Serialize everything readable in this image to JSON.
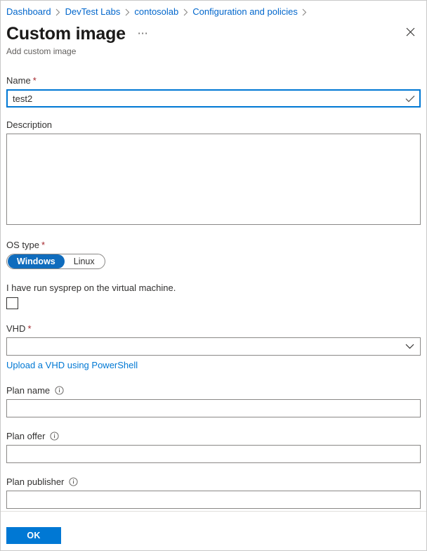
{
  "breadcrumb": {
    "items": [
      {
        "label": "Dashboard"
      },
      {
        "label": "DevTest Labs"
      },
      {
        "label": "contosolab"
      },
      {
        "label": "Configuration and policies"
      }
    ]
  },
  "header": {
    "title": "Custom image",
    "subtitle": "Add custom image",
    "more_label": "⋯",
    "close_label": "Close"
  },
  "form": {
    "name": {
      "label": "Name",
      "required_marker": "*",
      "value": "test2",
      "placeholder": "",
      "valid": true
    },
    "description": {
      "label": "Description",
      "value": "",
      "placeholder": ""
    },
    "os_type": {
      "label": "OS type",
      "required_marker": "*",
      "selected": "Windows",
      "options": [
        {
          "label": "Windows"
        },
        {
          "label": "Linux"
        }
      ]
    },
    "sysprep": {
      "label": "I have run sysprep on the virtual machine.",
      "checked": false
    },
    "vhd": {
      "label": "VHD",
      "required_marker": "*",
      "value": "",
      "options": [],
      "link_label": "Upload a VHD using PowerShell"
    },
    "plan_name": {
      "label": "Plan name",
      "value": "",
      "placeholder": "",
      "info": "i"
    },
    "plan_offer": {
      "label": "Plan offer",
      "value": "",
      "placeholder": "",
      "info": "i"
    },
    "plan_publisher": {
      "label": "Plan publisher",
      "value": "",
      "placeholder": "",
      "info": "i"
    }
  },
  "footer": {
    "ok_label": "OK"
  },
  "colors": {
    "accent": "#0078d4",
    "toggle_selected": "#0f6cbd",
    "required": "#a4262c",
    "link": "#0078d4",
    "border": "#8a8886",
    "text": "#323130"
  }
}
